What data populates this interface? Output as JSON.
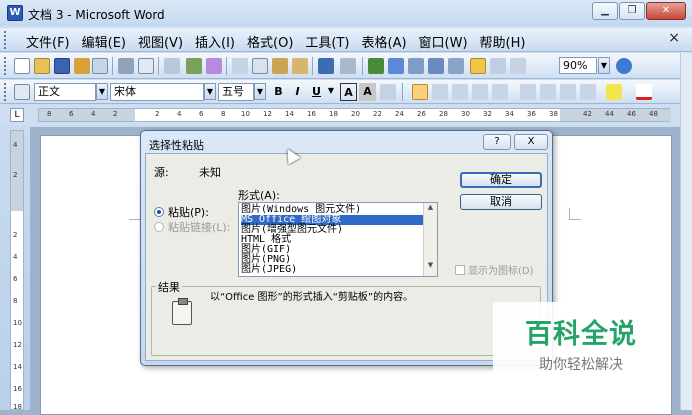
{
  "window": {
    "title": "文档 3 - Microsoft Word",
    "minimize_icon": "minimize-icon",
    "maximize_icon": "restore-icon",
    "close_icon": "close-icon"
  },
  "menu": {
    "items": [
      "文件(F)",
      "编辑(E)",
      "视图(V)",
      "插入(I)",
      "格式(O)",
      "工具(T)",
      "表格(A)",
      "窗口(W)",
      "帮助(H)"
    ],
    "close_glyph": "×"
  },
  "standard_toolbar": {
    "zoom": "90%"
  },
  "format_toolbar": {
    "style": "正文",
    "font": "宋体",
    "size": "五号",
    "bold": "B",
    "italic": "I",
    "underline": "U",
    "char_border": "A",
    "char_shading": "A"
  },
  "ruler": {
    "corner": "L",
    "ticks": [
      "8",
      "6",
      "4",
      "2",
      "2",
      "4",
      "6",
      "8",
      "10",
      "12",
      "14",
      "16",
      "18",
      "20",
      "22",
      "24",
      "26",
      "28",
      "30",
      "32",
      "34",
      "36",
      "38",
      "42",
      "44",
      "46",
      "48"
    ],
    "vticks": [
      "4",
      "2",
      "2",
      "4",
      "6",
      "8",
      "10",
      "12",
      "14",
      "16",
      "18"
    ]
  },
  "dialog": {
    "title": "选择性粘贴",
    "help": "?",
    "close": "X",
    "source_label": "源:",
    "source_value": "未知",
    "as_label": "形式(A):",
    "paste_label": "粘贴(P):",
    "paste_link_label": "粘贴链接(L):",
    "list": [
      "图片(Windows 图元文件)",
      "MS Office 绘图对象",
      "图片(增强型图元文件)",
      "HTML 格式",
      "图片(GIF)",
      "图片(PNG)",
      "图片(JPEG)"
    ],
    "selected_index": 1,
    "ok": "确定",
    "cancel": "取消",
    "display_as_icon": "显示为图标(D)",
    "result_label": "结果",
    "result_text": "以“Office 图形”的形式插入“剪贴板”的内容。"
  },
  "watermark": {
    "title": "百科全说",
    "subtitle": "助你轻松解决"
  }
}
